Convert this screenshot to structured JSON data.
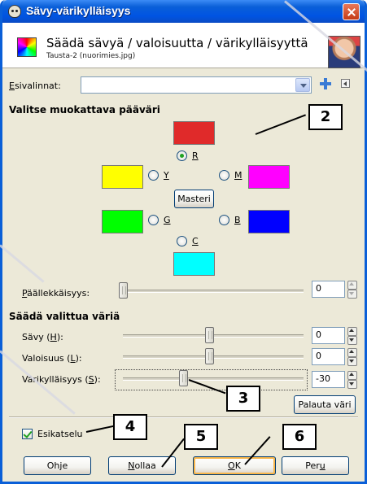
{
  "window": {
    "title": "Sävy-värikylläisyys",
    "close_label": ""
  },
  "header": {
    "title": "Säädä sävyä / valoisuutta / värikylläisyyttä",
    "subtitle": "Tausta-2 (nuorimies.jpg)"
  },
  "presets": {
    "label_prefix": "",
    "label_mnemonic": "E",
    "label_rest": "sivalinnat:",
    "value": ""
  },
  "primary": {
    "section_title": "Valitse muokattava pääväri",
    "colors": {
      "r": "#e02a2a",
      "y": "#ffff00",
      "m": "#ff00ff",
      "g": "#00ff00",
      "b": "#0000ff",
      "c": "#00ffff"
    },
    "labels": {
      "r": "R",
      "y": "Y",
      "m": "M",
      "g": "G",
      "b": "B",
      "c": "C"
    },
    "selected": "R",
    "master_label": "Masteri"
  },
  "overlap": {
    "label_mnemonic": "P",
    "label_rest": "äällekkäisyys:",
    "value": "0",
    "level": 0
  },
  "adjust": {
    "section_title": "Säädä valittua väriä",
    "hue": {
      "label_pre": "Sävy (",
      "label_mnemonic": "H",
      "label_post": "):",
      "value": "0",
      "level": 0.5
    },
    "lightness": {
      "label_pre": "Valoisuus (",
      "label_mnemonic": "L",
      "label_post": "):",
      "value": "0",
      "level": 0.5
    },
    "saturation": {
      "label_pre": "Värikylläisyys (",
      "label_mnemonic": "S",
      "label_post": "):",
      "value": "-30",
      "level": 0.35
    },
    "reset_label": "Palauta väri"
  },
  "preview": {
    "label": "Esikatselu",
    "checked": true
  },
  "buttons": {
    "help": {
      "pre": "Oh",
      "mnemonic": "j",
      "post": "e"
    },
    "reset": {
      "pre": "",
      "mnemonic": "N",
      "post": "ollaa"
    },
    "ok": {
      "pre": "",
      "mnemonic": "O",
      "post": "K"
    },
    "cancel": {
      "pre": "Per",
      "mnemonic": "u",
      "post": ""
    }
  },
  "callouts": [
    "2",
    "3",
    "4",
    "5",
    "6"
  ],
  "colors": {
    "accent_titlebar": "#0054e3",
    "dialog_bg": "#ece9d8"
  }
}
